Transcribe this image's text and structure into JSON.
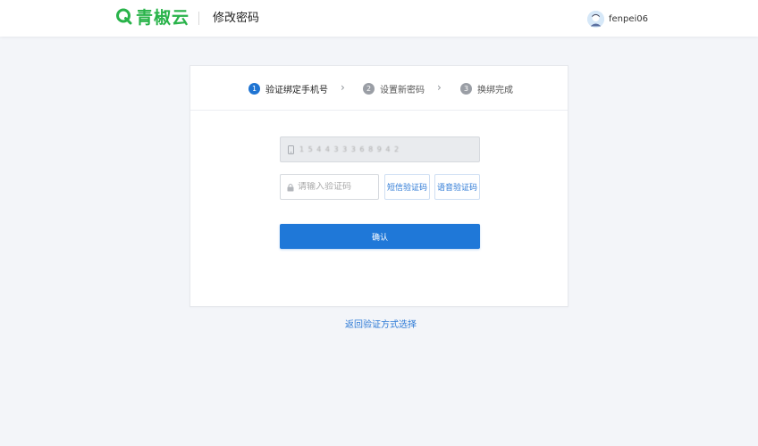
{
  "header": {
    "logo_text": "青椒云",
    "page_title": "修改密码",
    "username": "fenpei06",
    "brand_color": "#29b34a"
  },
  "steps": [
    {
      "number": "1",
      "label": "验证绑定手机号",
      "state": "active"
    },
    {
      "number": "2",
      "label": "设置新密码",
      "state": "inactive"
    },
    {
      "number": "3",
      "label": "换绑完成",
      "state": "inactive"
    }
  ],
  "form": {
    "phone_value": "1 5 4 4 3 3 3 6 8 9 4 2",
    "code_placeholder": "请输入验证码",
    "sms_button": "短信验证码",
    "voice_button": "语音验证码",
    "confirm_button": "确认"
  },
  "back_link": "返回验证方式选择",
  "colors": {
    "accent": "#1f78d8",
    "page_bg": "#f3f5f9"
  },
  "icons": {
    "logo": "q-logo-icon",
    "avatar": "user-avatar-icon",
    "phone": "phone-icon",
    "lock": "lock-icon",
    "arrow": "chevron-right-icon"
  }
}
